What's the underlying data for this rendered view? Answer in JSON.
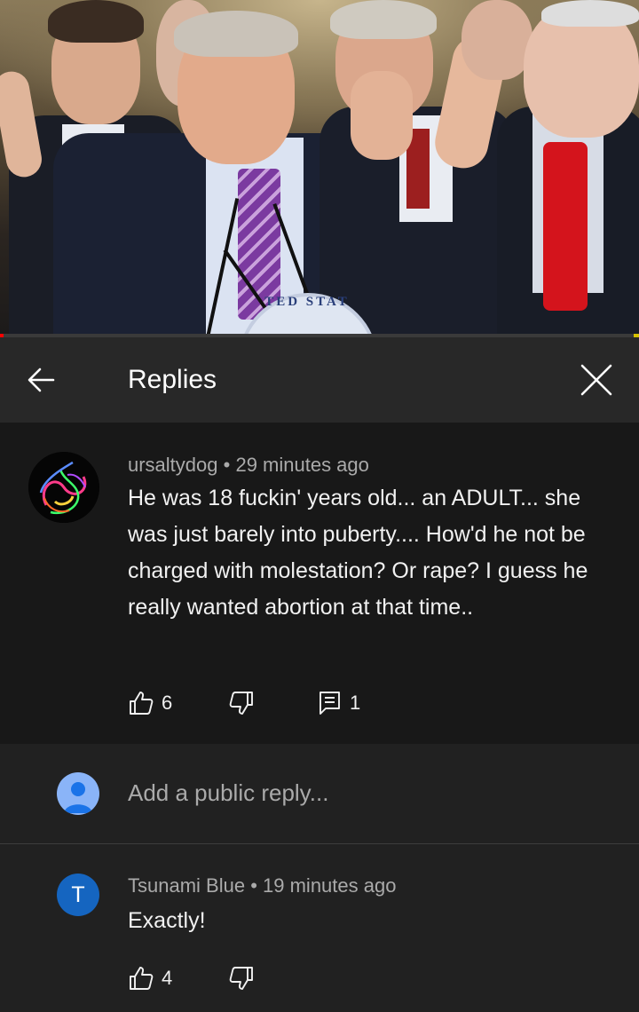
{
  "video": {
    "seal_text": "TED STAT",
    "progress_fraction": 0.005
  },
  "header": {
    "title": "Replies",
    "back_icon": "arrow-left-icon",
    "close_icon": "close-icon"
  },
  "parent_comment": {
    "author": "ursaltydog",
    "separator": " • ",
    "time": "29 minutes ago",
    "text": "He was 18 fuckin' years old... an ADULT... she was just barely into puberty.... How'd he not be charged with molestation? Or rape? I guess he really wanted abortion at that time..",
    "likes": "6",
    "replies": "1"
  },
  "reply_box": {
    "placeholder": "Add a public reply..."
  },
  "replies": [
    {
      "author": "Tsunami Blue",
      "separator": " • ",
      "time": "19 minutes ago",
      "initial": "T",
      "text": "Exactly!",
      "likes": "4",
      "avatar_color": "#1565c0"
    }
  ],
  "colors": {
    "background": "#212121",
    "parent_background": "#181818",
    "header_background": "#282828",
    "secondary_text": "#aaaaaa",
    "progress": "#ff0000"
  }
}
